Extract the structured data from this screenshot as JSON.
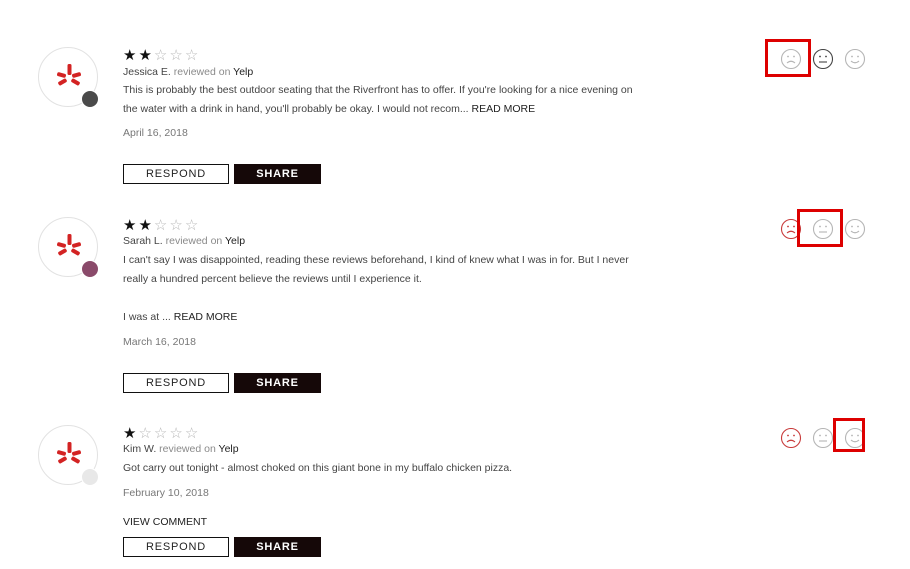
{
  "reviews": [
    {
      "stars": 2,
      "max_stars": 5,
      "author": "Jessica E.",
      "reviewed_word": "reviewed",
      "on_word": "on",
      "platform": "Yelp",
      "text_lines": [
        "This is probably the best outdoor seating that the Riverfront has to offer.  If you're looking for a nice evening on",
        "the water with a drink in hand, you'll probably be okay.  I would not recom..."
      ],
      "read_more": "READ MORE",
      "date": "April 16, 2018",
      "respond_label": "RESPOND",
      "share_label": "SHARE",
      "sentiment_selected": "negative"
    },
    {
      "stars": 2,
      "max_stars": 5,
      "author": "Sarah L.",
      "reviewed_word": "reviewed",
      "on_word": "on",
      "platform": "Yelp",
      "text_lines": [
        "I can't say I was disappointed, reading these reviews beforehand, I kind of knew what I was in for. But I never",
        "really a hundred percent believe the reviews until I experience it.",
        "",
        "I was at ..."
      ],
      "read_more": "READ MORE",
      "date": "March 16, 2018",
      "respond_label": "RESPOND",
      "share_label": "SHARE",
      "sentiment_selected": "neutral"
    },
    {
      "stars": 1,
      "max_stars": 5,
      "author": "Kim W.",
      "reviewed_word": "reviewed",
      "on_word": "on",
      "platform": "Yelp",
      "text_lines": [
        "Got carry out tonight - almost choked on this giant bone in my buffalo chicken pizza."
      ],
      "read_more": "",
      "date": "February 10, 2018",
      "view_comment": "VIEW COMMENT",
      "respond_label": "RESPOND",
      "share_label": "SHARE",
      "sentiment_selected": "positive"
    }
  ],
  "colors": {
    "yelp_red": "#d32323",
    "highlight": "#dd0000",
    "share_bg": "#150808",
    "face_gray": "#b5b5b5",
    "face_dark": "#444444",
    "face_red": "#c83a3a"
  },
  "icons": {
    "negative": "frown-face-icon",
    "neutral": "neutral-face-icon",
    "positive": "smile-face-icon",
    "platform": "yelp-logo-icon"
  }
}
